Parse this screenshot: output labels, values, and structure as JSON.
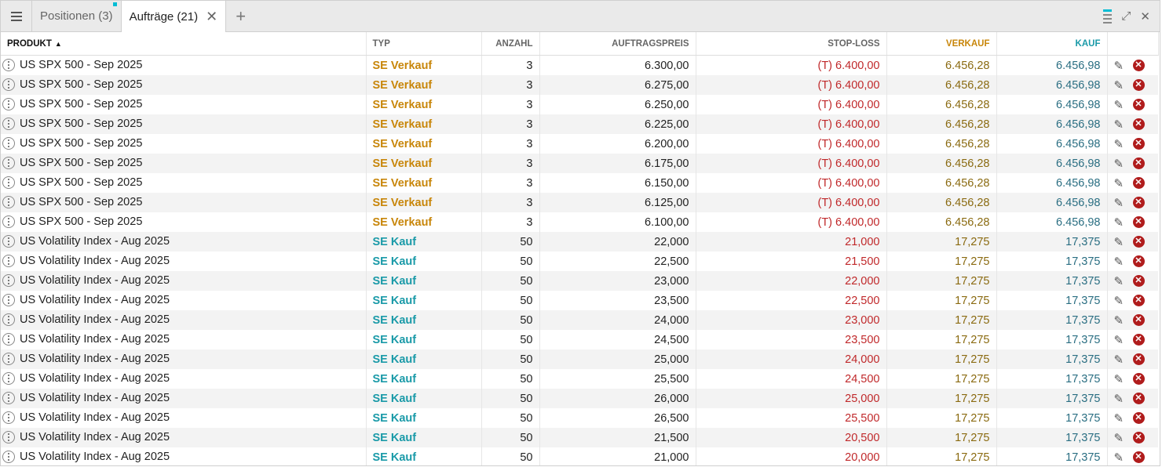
{
  "tabs": {
    "positions_label": "Positionen (3)",
    "orders_label": "Aufträge (21)",
    "close_glyph": "✕",
    "add_glyph": "+"
  },
  "toolbar": {
    "expand_glyph": "⤢",
    "close_glyph": "✕"
  },
  "columns": {
    "produkt": "PRODUKT",
    "typ": "TYP",
    "anzahl": "ANZAHL",
    "auftragspreis": "AUFTRAGSPREIS",
    "stoploss": "STOP-LOSS",
    "verkauf": "VERKAUF",
    "kauf": "KAUF",
    "sort_glyph": "▲"
  },
  "icons": {
    "row_menu": "more-vertical-icon",
    "edit": "pencil-icon",
    "cancel": "close-circle-icon"
  },
  "colors": {
    "sell": "#c8860a",
    "buy": "#1a9aa8",
    "stoploss": "#c0282a",
    "accent": "#00bcd4"
  },
  "rows": [
    {
      "produkt": "US SPX 500 - Sep 2025",
      "typ": "SE Verkauf",
      "side": "sell",
      "anzahl": "3",
      "preis": "6.300,00",
      "stoploss": "(T) 6.400,00",
      "verkauf": "6.456,28",
      "kauf": "6.456,98"
    },
    {
      "produkt": "US SPX 500 - Sep 2025",
      "typ": "SE Verkauf",
      "side": "sell",
      "anzahl": "3",
      "preis": "6.275,00",
      "stoploss": "(T) 6.400,00",
      "verkauf": "6.456,28",
      "kauf": "6.456,98"
    },
    {
      "produkt": "US SPX 500 - Sep 2025",
      "typ": "SE Verkauf",
      "side": "sell",
      "anzahl": "3",
      "preis": "6.250,00",
      "stoploss": "(T) 6.400,00",
      "verkauf": "6.456,28",
      "kauf": "6.456,98"
    },
    {
      "produkt": "US SPX 500 - Sep 2025",
      "typ": "SE Verkauf",
      "side": "sell",
      "anzahl": "3",
      "preis": "6.225,00",
      "stoploss": "(T) 6.400,00",
      "verkauf": "6.456,28",
      "kauf": "6.456,98"
    },
    {
      "produkt": "US SPX 500 - Sep 2025",
      "typ": "SE Verkauf",
      "side": "sell",
      "anzahl": "3",
      "preis": "6.200,00",
      "stoploss": "(T) 6.400,00",
      "verkauf": "6.456,28",
      "kauf": "6.456,98"
    },
    {
      "produkt": "US SPX 500 - Sep 2025",
      "typ": "SE Verkauf",
      "side": "sell",
      "anzahl": "3",
      "preis": "6.175,00",
      "stoploss": "(T) 6.400,00",
      "verkauf": "6.456,28",
      "kauf": "6.456,98"
    },
    {
      "produkt": "US SPX 500 - Sep 2025",
      "typ": "SE Verkauf",
      "side": "sell",
      "anzahl": "3",
      "preis": "6.150,00",
      "stoploss": "(T) 6.400,00",
      "verkauf": "6.456,28",
      "kauf": "6.456,98"
    },
    {
      "produkt": "US SPX 500 - Sep 2025",
      "typ": "SE Verkauf",
      "side": "sell",
      "anzahl": "3",
      "preis": "6.125,00",
      "stoploss": "(T) 6.400,00",
      "verkauf": "6.456,28",
      "kauf": "6.456,98"
    },
    {
      "produkt": "US SPX 500 - Sep 2025",
      "typ": "SE Verkauf",
      "side": "sell",
      "anzahl": "3",
      "preis": "6.100,00",
      "stoploss": "(T) 6.400,00",
      "verkauf": "6.456,28",
      "kauf": "6.456,98"
    },
    {
      "produkt": "US Volatility Index - Aug 2025",
      "typ": "SE Kauf",
      "side": "buy",
      "anzahl": "50",
      "preis": "22,000",
      "stoploss": "21,000",
      "verkauf": "17,275",
      "kauf": "17,375"
    },
    {
      "produkt": "US Volatility Index - Aug 2025",
      "typ": "SE Kauf",
      "side": "buy",
      "anzahl": "50",
      "preis": "22,500",
      "stoploss": "21,500",
      "verkauf": "17,275",
      "kauf": "17,375"
    },
    {
      "produkt": "US Volatility Index - Aug 2025",
      "typ": "SE Kauf",
      "side": "buy",
      "anzahl": "50",
      "preis": "23,000",
      "stoploss": "22,000",
      "verkauf": "17,275",
      "kauf": "17,375"
    },
    {
      "produkt": "US Volatility Index - Aug 2025",
      "typ": "SE Kauf",
      "side": "buy",
      "anzahl": "50",
      "preis": "23,500",
      "stoploss": "22,500",
      "verkauf": "17,275",
      "kauf": "17,375"
    },
    {
      "produkt": "US Volatility Index - Aug 2025",
      "typ": "SE Kauf",
      "side": "buy",
      "anzahl": "50",
      "preis": "24,000",
      "stoploss": "23,000",
      "verkauf": "17,275",
      "kauf": "17,375"
    },
    {
      "produkt": "US Volatility Index - Aug 2025",
      "typ": "SE Kauf",
      "side": "buy",
      "anzahl": "50",
      "preis": "24,500",
      "stoploss": "23,500",
      "verkauf": "17,275",
      "kauf": "17,375"
    },
    {
      "produkt": "US Volatility Index - Aug 2025",
      "typ": "SE Kauf",
      "side": "buy",
      "anzahl": "50",
      "preis": "25,000",
      "stoploss": "24,000",
      "verkauf": "17,275",
      "kauf": "17,375"
    },
    {
      "produkt": "US Volatility Index - Aug 2025",
      "typ": "SE Kauf",
      "side": "buy",
      "anzahl": "50",
      "preis": "25,500",
      "stoploss": "24,500",
      "verkauf": "17,275",
      "kauf": "17,375"
    },
    {
      "produkt": "US Volatility Index - Aug 2025",
      "typ": "SE Kauf",
      "side": "buy",
      "anzahl": "50",
      "preis": "26,000",
      "stoploss": "25,000",
      "verkauf": "17,275",
      "kauf": "17,375"
    },
    {
      "produkt": "US Volatility Index - Aug 2025",
      "typ": "SE Kauf",
      "side": "buy",
      "anzahl": "50",
      "preis": "26,500",
      "stoploss": "25,500",
      "verkauf": "17,275",
      "kauf": "17,375"
    },
    {
      "produkt": "US Volatility Index - Aug 2025",
      "typ": "SE Kauf",
      "side": "buy",
      "anzahl": "50",
      "preis": "21,500",
      "stoploss": "20,500",
      "verkauf": "17,275",
      "kauf": "17,375"
    },
    {
      "produkt": "US Volatility Index - Aug 2025",
      "typ": "SE Kauf",
      "side": "buy",
      "anzahl": "50",
      "preis": "21,000",
      "stoploss": "20,000",
      "verkauf": "17,275",
      "kauf": "17,375"
    }
  ]
}
